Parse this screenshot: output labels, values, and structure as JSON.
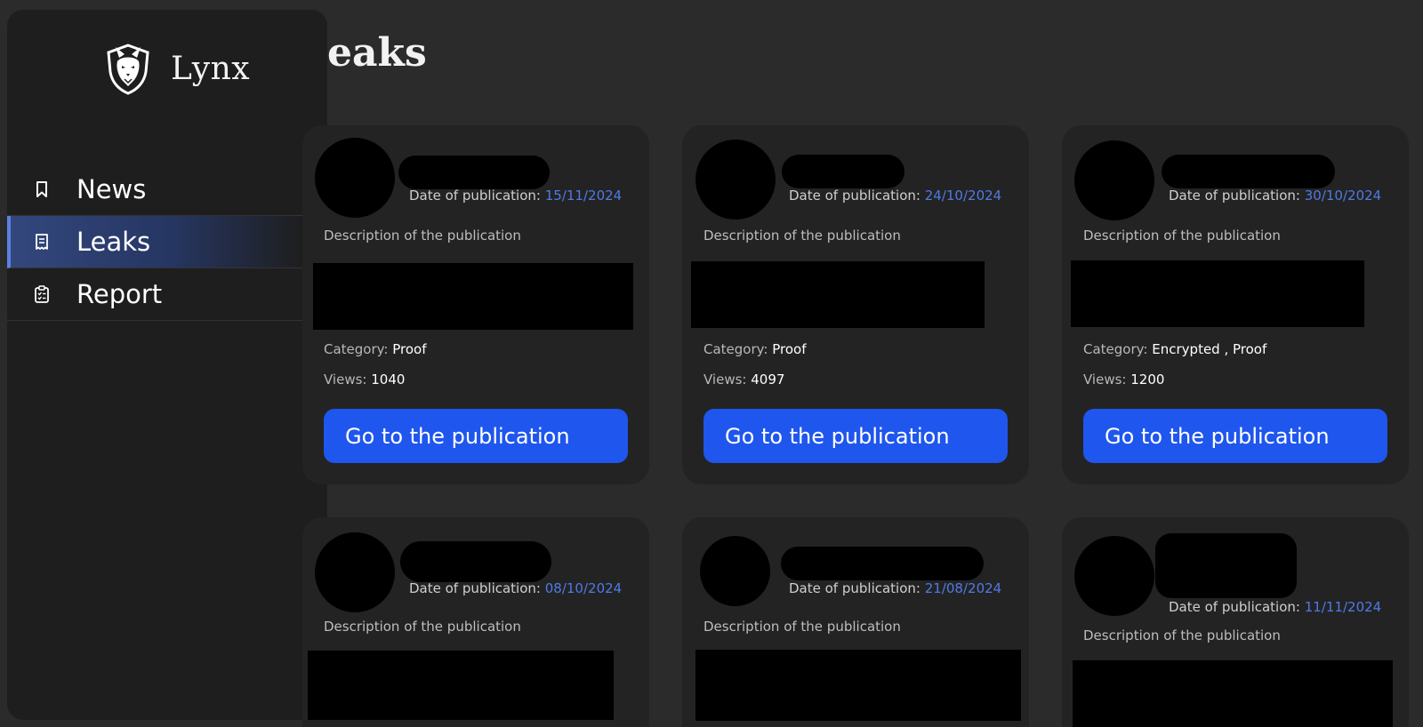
{
  "app": {
    "name": "Lynx"
  },
  "sidebar": {
    "items": [
      {
        "label": "News",
        "icon": "bookmark-icon"
      },
      {
        "label": "Leaks",
        "icon": "receipt-icon",
        "active": true
      },
      {
        "label": "Report",
        "icon": "clipboard-checklist-icon"
      }
    ]
  },
  "page": {
    "title": "eaks"
  },
  "colors": {
    "accent": "#1f56ed",
    "date": "#4f7ae6",
    "active_nav": "#33477d",
    "background": "#2b2b2b",
    "card": "#232323"
  },
  "cards": [
    {
      "date_label": "Date of publication:",
      "date": "15/11/2024",
      "description": "Description of the publication",
      "category_label": "Category:",
      "category": "Proof",
      "views_label": "Views:",
      "views": "1040",
      "button": "Go to the publication"
    },
    {
      "date_label": "Date of publication:",
      "date": "24/10/2024",
      "description": "Description of the publication",
      "category_label": "Category:",
      "category": "Proof",
      "views_label": "Views:",
      "views": "4097",
      "button": "Go to the publication"
    },
    {
      "date_label": "Date of publication:",
      "date": "30/10/2024",
      "description": "Description of the publication",
      "category_label": "Category:",
      "category": "Encrypted , Proof",
      "views_label": "Views:",
      "views": "1200",
      "button": "Go to the publication"
    },
    {
      "date_label": "Date of publication:",
      "date": "08/10/2024",
      "description": "Description of the publication"
    },
    {
      "date_label": "Date of publication:",
      "date": "21/08/2024",
      "description": "Description of the publication"
    },
    {
      "date_label": "Date of publication:",
      "date": "11/11/2024",
      "description": "Description of the publication"
    }
  ]
}
